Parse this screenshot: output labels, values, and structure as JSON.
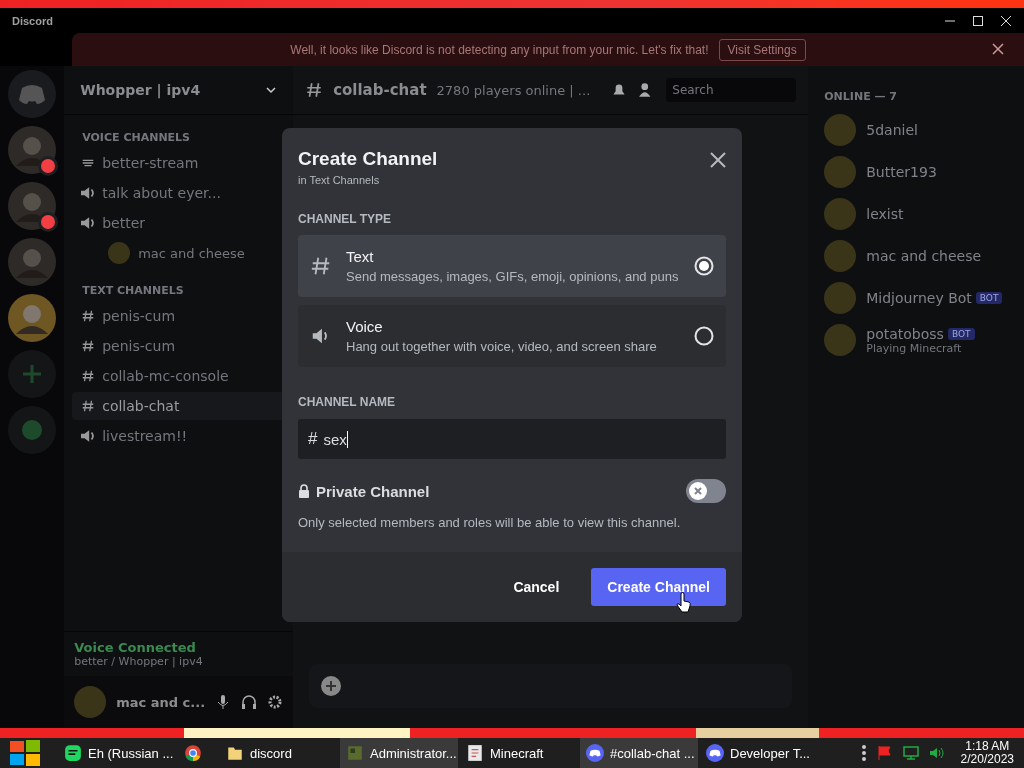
{
  "window": {
    "title": "Discord"
  },
  "notice": {
    "text": "Well, it looks like Discord is not detecting any input from your mic. Let's fix that!",
    "button": "Visit Settings"
  },
  "servers": [
    {
      "kind": "home",
      "unread": false,
      "selected": false
    },
    {
      "kind": "avatar",
      "unread": true,
      "selected": false
    },
    {
      "kind": "avatar",
      "unread": true,
      "selected": false
    },
    {
      "kind": "avatar",
      "unread": false,
      "selected": false
    },
    {
      "kind": "avatar",
      "unread": false,
      "selected": true
    },
    {
      "kind": "add",
      "unread": false,
      "selected": false
    },
    {
      "kind": "explore",
      "unread": false,
      "selected": false
    }
  ],
  "server": {
    "name": "Whopper | ipv4"
  },
  "channel_groups": [
    {
      "title": "VOICE CHANNELS",
      "channels": [
        {
          "kind": "stage",
          "name": "better-stream",
          "selected": false
        },
        {
          "kind": "voice",
          "name": "talk about eyer...",
          "selected": false
        },
        {
          "kind": "voice",
          "name": "better",
          "selected": false,
          "members": [
            "mac and cheese"
          ]
        }
      ]
    },
    {
      "title": "TEXT CHANNELS",
      "channels": [
        {
          "kind": "text",
          "name": "penis-cum",
          "selected": false
        },
        {
          "kind": "text",
          "name": "penis-cum",
          "selected": false
        },
        {
          "kind": "text",
          "name": "collab-mc-console",
          "selected": false
        },
        {
          "kind": "text",
          "name": "collab-chat",
          "selected": true
        },
        {
          "kind": "voice",
          "name": "livestream!!",
          "selected": false
        }
      ]
    }
  ],
  "voice_status": {
    "title": "Voice Connected",
    "location": "better / Whopper | ipv4"
  },
  "user": {
    "name": "mac and c..."
  },
  "chat_header": {
    "channel": "collab-chat",
    "topic": "2780 players online | ...",
    "search_placeholder": "Search"
  },
  "members": {
    "heading": "ONLINE — 7",
    "list": [
      {
        "name": "5daniel"
      },
      {
        "name": "Butter193"
      },
      {
        "name": "lexist"
      },
      {
        "name": "mac and cheese"
      },
      {
        "name": "Midjourney Bot",
        "tag": "BOT"
      },
      {
        "name": "potatoboss",
        "tag": "BOT",
        "activity": "Playing Minecraft"
      }
    ]
  },
  "dialog": {
    "title": "Create Channel",
    "subtitle": "in Text Channels",
    "type_label": "CHANNEL TYPE",
    "types": [
      {
        "kind": "text",
        "name": "Text",
        "description": "Send messages, images, GIFs, emoji, opinions, and puns",
        "selected": true
      },
      {
        "kind": "voice",
        "name": "Voice",
        "description": "Hang out together with voice, video, and screen share",
        "selected": false
      }
    ],
    "name_label": "CHANNEL NAME",
    "prefix": "#",
    "name_value": "sex",
    "private": {
      "label": "Private Channel",
      "on": false,
      "description": "Only selected members and roles will be able to view this channel."
    },
    "buttons": [
      {
        "kind": "secondary",
        "label": "Cancel"
      },
      {
        "kind": "primary",
        "label": "Create Channel"
      }
    ]
  },
  "taskbar": {
    "items": [
      {
        "kind": "music",
        "label": "Eh (Russian ...",
        "active": false
      },
      {
        "kind": "browser",
        "active": false
      },
      {
        "kind": "folder",
        "label": "discord",
        "active": false
      },
      {
        "kind": "server",
        "label": "Administrator...",
        "active": true
      },
      {
        "kind": "java",
        "label": "Minecraft",
        "active": false
      },
      {
        "kind": "discord",
        "label": "#collab-chat ...",
        "active": true
      },
      {
        "kind": "discord",
        "label": "Developer T...",
        "active": false
      }
    ],
    "time": "1:18 AM",
    "date": "2/20/2023"
  }
}
